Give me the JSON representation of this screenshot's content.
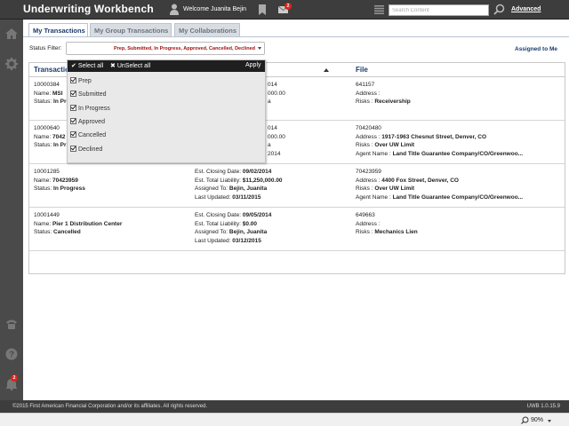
{
  "header": {
    "title": "Underwriting Workbench",
    "welcome": "Welcome Juanita Bejin",
    "mail_count": "2",
    "search_placeholder": "Search Content",
    "advanced_label": "Advanced"
  },
  "sidebar": {
    "notification_count": "2"
  },
  "tabs": [
    {
      "label": "My Transactions"
    },
    {
      "label": "My Group Transactions"
    },
    {
      "label": "My Collaborations"
    }
  ],
  "filter": {
    "label": "Status Filter:",
    "value": "Prep, Submitted, In Progress, Approved, Cancelled, Declined",
    "assigned_label": "Assigned to Me"
  },
  "dropdown": {
    "select_all": "Select all",
    "unselect_all": "UnSelect all",
    "apply": "Apply",
    "options": [
      "Prep",
      "Submitted",
      "In Progress",
      "Approved",
      "Cancelled",
      "Declined"
    ]
  },
  "table": {
    "headers": [
      "Transaction",
      "File"
    ],
    "rows": [
      {
        "c1": [
          "10000384",
          "Name:",
          "MSI",
          "Status:",
          "In Progress"
        ],
        "c2": [
          "014",
          "000.00",
          "a"
        ],
        "c3": [
          "641157",
          "Address :",
          "",
          "Risks :",
          "Receivership"
        ]
      },
      {
        "c1": [
          "10000640",
          "Name:",
          "7042",
          "Status:",
          "In Pr"
        ],
        "c2": [
          "014",
          "000.00",
          "a",
          "2014"
        ],
        "c3": [
          "70420480",
          "Address :",
          "1917-1963 Chesnut Street, Denver, CO",
          "Risks :",
          "Over UW Limit",
          "Agent Name :",
          "Land Title Guarantee Company/CO/Greenwoo..."
        ]
      },
      {
        "c1": [
          "10001285",
          "Name:",
          "70423959",
          "Status:",
          "In Progress"
        ],
        "c2": [
          "Est. Closing Date:",
          "09/02/2014",
          "Est. Total Liability:",
          "$11,250,000.00",
          "Assigned To:",
          "Bejin, Juanita",
          "Last Updated:",
          "03/11/2015"
        ],
        "c3": [
          "70423959",
          "Address :",
          "4400 Fox Street, Denver, CO",
          "Risks :",
          "Over UW Limit",
          "Agent Name :",
          "Land Title Guarantee Company/CO/Greenwoo..."
        ]
      },
      {
        "c1": [
          "10001449",
          "Name:",
          "Pier 1 Distribution Center",
          "Status:",
          "Cancelled"
        ],
        "c2": [
          "Est. Closing Date:",
          "09/05/2014",
          "Est. Total Liability:",
          "$0.00",
          "Assigned To:",
          "Bejin, Juanita",
          "Last Updated:",
          "03/12/2015"
        ],
        "c3": [
          "649663",
          "Address :",
          "",
          "Risks :",
          "Mechanics Lien"
        ]
      }
    ]
  },
  "footer": {
    "copyright": "©2015 First American Financial Corporation and/or its affiliates. All rights reserved.",
    "version": "UWB 1.0.15.9"
  },
  "statusbar": {
    "zoom": "90%"
  },
  "colors": {
    "header_bg": "#3d3d3d",
    "accent_blue": "#1a3a6c",
    "status_red": "#a01010",
    "badge_red": "#d9261c"
  }
}
